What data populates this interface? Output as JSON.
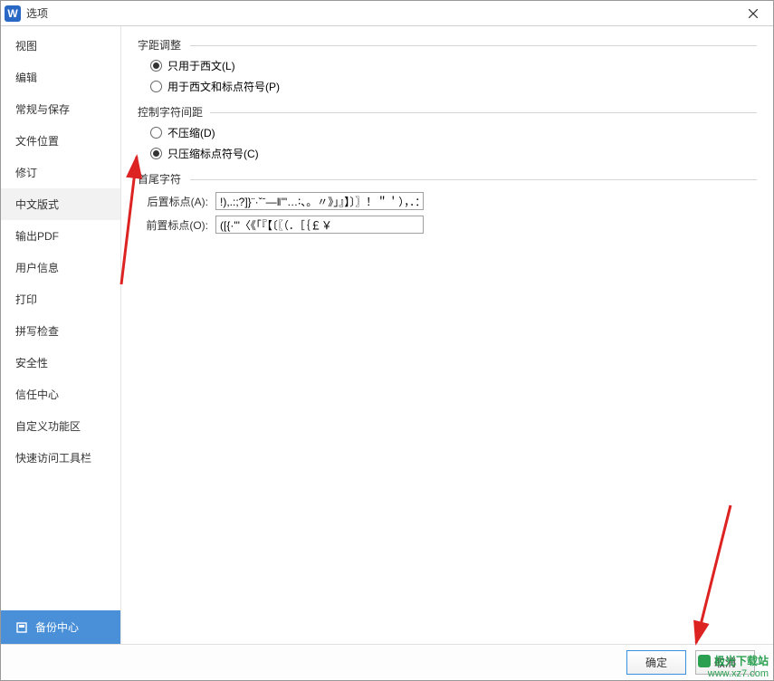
{
  "titlebar": {
    "icon_letter": "W",
    "title": "选项"
  },
  "sidebar": {
    "items": [
      {
        "label": "视图"
      },
      {
        "label": "编辑"
      },
      {
        "label": "常规与保存"
      },
      {
        "label": "文件位置"
      },
      {
        "label": "修订"
      },
      {
        "label": "中文版式"
      },
      {
        "label": "输出PDF"
      },
      {
        "label": "用户信息"
      },
      {
        "label": "打印"
      },
      {
        "label": "拼写检查"
      },
      {
        "label": "安全性"
      },
      {
        "label": "信任中心"
      },
      {
        "label": "自定义功能区"
      },
      {
        "label": "快速访问工具栏"
      }
    ],
    "selected_index": 5,
    "backup_center": "备份中心"
  },
  "content": {
    "group1": {
      "title": "字距调整",
      "option1": "只用于西文(L)",
      "option2": "用于西文和标点符号(P)",
      "selected": 0
    },
    "group2": {
      "title": "控制字符间距",
      "option1": "不压缩(D)",
      "option2": "只压缩标点符号(C)",
      "selected": 1
    },
    "group3": {
      "title": "首尾字符",
      "field1_label": "后置标点(A):",
      "field1_value": "!),.:;?]}¨·ˇˉ―‖'\"…∶、。〃》」』】〕〗！＂＇），．：；？］｀｜｝～￠",
      "field2_label": "前置标点(O):",
      "field2_value": "([{·'\"〈《「『【〔〖（．［｛￡￥"
    }
  },
  "buttons": {
    "ok": "确定",
    "cancel": "取消"
  },
  "watermark": {
    "line1": "极光下载站",
    "line2": "www.xz7.com"
  }
}
